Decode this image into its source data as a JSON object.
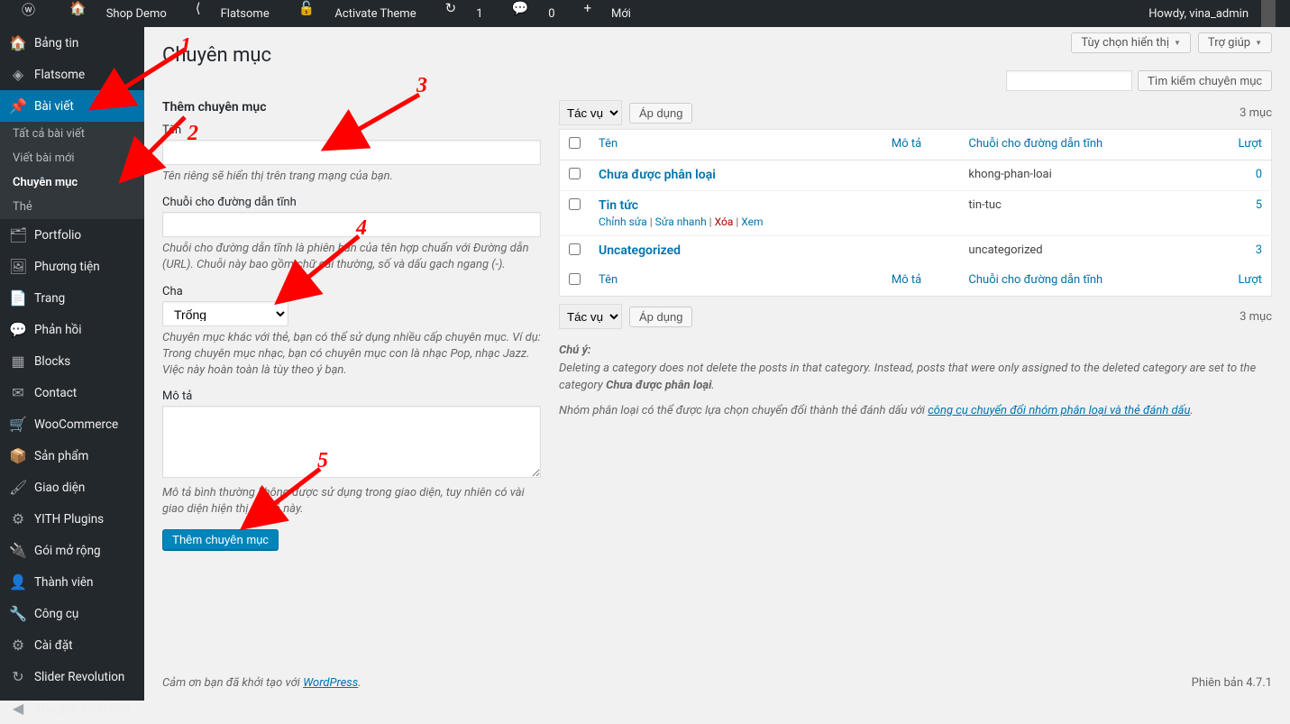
{
  "adminbar": {
    "site_name": "Shop Demo",
    "theme_label": "Flatsome",
    "activate_theme": "Activate Theme",
    "updates": "1",
    "comments": "0",
    "new_label": "Mới",
    "howdy": "Howdy, vina_admin"
  },
  "sidebar": {
    "items": [
      {
        "label": "Bảng tin",
        "icon": "🏠"
      },
      {
        "label": "Flatsome",
        "icon": "◈"
      },
      {
        "label": "Bài viết",
        "icon": "📌"
      },
      {
        "label": "Portfolio",
        "icon": "🗂"
      },
      {
        "label": "Phương tiện",
        "icon": "🖼"
      },
      {
        "label": "Trang",
        "icon": "📄"
      },
      {
        "label": "Phản hồi",
        "icon": "💬"
      },
      {
        "label": "Blocks",
        "icon": "▦"
      },
      {
        "label": "Contact",
        "icon": "✉"
      },
      {
        "label": "WooCommerce",
        "icon": "🛒"
      },
      {
        "label": "Sản phẩm",
        "icon": "📦"
      },
      {
        "label": "Giao diện",
        "icon": "🖌"
      },
      {
        "label": "YITH Plugins",
        "icon": "⚙"
      },
      {
        "label": "Gói mở rộng",
        "icon": "🔌"
      },
      {
        "label": "Thành viên",
        "icon": "👤"
      },
      {
        "label": "Công cụ",
        "icon": "🔧"
      },
      {
        "label": "Cài đặt",
        "icon": "⚙"
      },
      {
        "label": "Slider Revolution",
        "icon": "↻"
      },
      {
        "label": "Thu gọn trình đơn",
        "icon": "◀"
      }
    ],
    "submenu_posts": [
      "Tất cả bài viết",
      "Viết bài mới",
      "Chuyên mục",
      "Thẻ"
    ]
  },
  "page": {
    "title": "Chuyên mục",
    "screen_options": "Tùy chọn hiển thị",
    "help": "Trợ giúp"
  },
  "form": {
    "section_title": "Thêm chuyên mục",
    "name_label": "Tên",
    "name_help": "Tên riêng sẽ hiển thị trên trang mạng của bạn.",
    "slug_label": "Chuỗi cho đường dẫn tĩnh",
    "slug_help": "Chuỗi cho đường dẫn tĩnh là phiên bản của tên hợp chuẩn với Đường dẫn (URL). Chuỗi này bao gồm chữ cái thường, số và dấu gạch ngang (-).",
    "parent_label": "Cha",
    "parent_selected": "Trống",
    "parent_help": "Chuyên mục khác với thẻ, bạn có thể sử dụng nhiều cấp chuyên mục. Ví dụ: Trong chuyên mục nhạc, bạn có chuyên mục con là nhạc Pop, nhạc Jazz. Việc này hoàn toàn là tùy theo ý bạn.",
    "desc_label": "Mô tả",
    "desc_help": "Mô tả bình thường không được sử dụng trong giao diện, tuy nhiên có vài giao diện hiện thị mô tả này.",
    "submit": "Thêm chuyên mục"
  },
  "list": {
    "search_button": "Tìm kiếm chuyên mục",
    "bulk_label": "Tác vụ",
    "apply": "Áp dụng",
    "count": "3 mục",
    "columns": {
      "name": "Tên",
      "desc": "Mô tả",
      "slug": "Chuỗi cho đường dẫn tĩnh",
      "count": "Lượt"
    },
    "rows": [
      {
        "name": "Chưa được phân loại",
        "slug": "khong-phan-loai",
        "count": "0",
        "actions": false
      },
      {
        "name": "Tin tức",
        "slug": "tin-tuc",
        "count": "5",
        "actions": true
      },
      {
        "name": "Uncategorized",
        "slug": "uncategorized",
        "count": "3",
        "actions": false
      }
    ],
    "row_actions": {
      "edit": "Chỉnh sửa",
      "quick": "Sửa nhanh",
      "delete": "Xóa",
      "view": "Xem"
    }
  },
  "notes": {
    "heading": "Chú ý:",
    "line1a": "Deleting a category does not delete the posts in that category. Instead, posts that were only assigned to the deleted category are set to the category ",
    "line1b": "Chưa được phân loại",
    "line2a": "Nhóm phân loại có thể được lựa chọn chuyển đổi thành thẻ đánh dấu với ",
    "line2b": "công cụ chuyển đổi nhóm phân loại và thẻ đánh dấu"
  },
  "footer": {
    "thanks": "Cảm ơn bạn đã khởi tạo với ",
    "wp": "WordPress",
    "version": "Phiên bản 4.7.1"
  },
  "annotations": [
    "1",
    "2",
    "3",
    "4",
    "5"
  ]
}
